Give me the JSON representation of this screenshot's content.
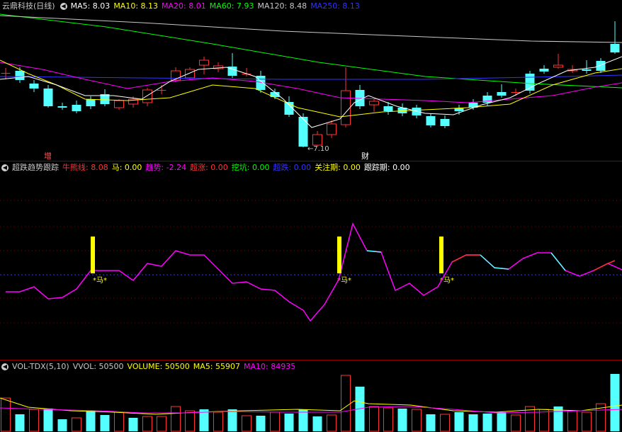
{
  "price_panel": {
    "title": "云鼎科技(日线)",
    "ma_labels": [
      {
        "text": "MA5: 8.03",
        "color": "#ffffff"
      },
      {
        "text": "MA10: 8.13",
        "color": "#ffff00"
      },
      {
        "text": "MA20: 8.01",
        "color": "#ff00ff"
      },
      {
        "text": "MA60: 7.93",
        "color": "#00ff00"
      },
      {
        "text": "MA120: 8.48",
        "color": "#c8c8c8"
      },
      {
        "text": "MA250: 8.13",
        "color": "#3333ff"
      }
    ],
    "low_annotation": "7.10",
    "marker_zeng": "增",
    "marker_cai": "财"
  },
  "indicator_panel": {
    "circle_glyph": "◀",
    "title": "超跌趋势跟踪",
    "labels": [
      {
        "text": "牛熊线: 8.08",
        "color": "#ff3333"
      },
      {
        "text": "马: 0.00",
        "color": "#ffff00"
      },
      {
        "text": "趋势: -2.24",
        "color": "#ff00ff"
      },
      {
        "text": "超涨: 0.00",
        "color": "#ff3333"
      },
      {
        "text": "挖坑: 0.00",
        "color": "#00ff00"
      },
      {
        "text": "超跌: 0.00",
        "color": "#3333ff"
      },
      {
        "text": "关注期: 0.00",
        "color": "#ffff00"
      },
      {
        "text": "跟踪期: 0.00",
        "color": "#ffffff"
      }
    ],
    "signal_text": "*马*"
  },
  "volume_panel": {
    "circle_glyph": "◀",
    "labels": [
      {
        "text": "VOL-TDX(5,10)",
        "color": "#c8c8c8"
      },
      {
        "text": "VVOL: 50500",
        "color": "#c8c8c8"
      },
      {
        "text": "VOLUME: 50500",
        "color": "#ffff00"
      },
      {
        "text": "MA5: 55907",
        "color": "#ffff00"
      },
      {
        "text": "MA10: 84935",
        "color": "#ff00ff"
      }
    ]
  },
  "colors": {
    "up": "#ff3232",
    "down": "#54ffff",
    "grid": "#8b0000",
    "ma5": "#ffffff",
    "ma10": "#ffff00",
    "ma20": "#ff00ff",
    "ma60": "#00ff00",
    "ma120": "#c8c8c8",
    "ma250": "#3333ff"
  }
}
